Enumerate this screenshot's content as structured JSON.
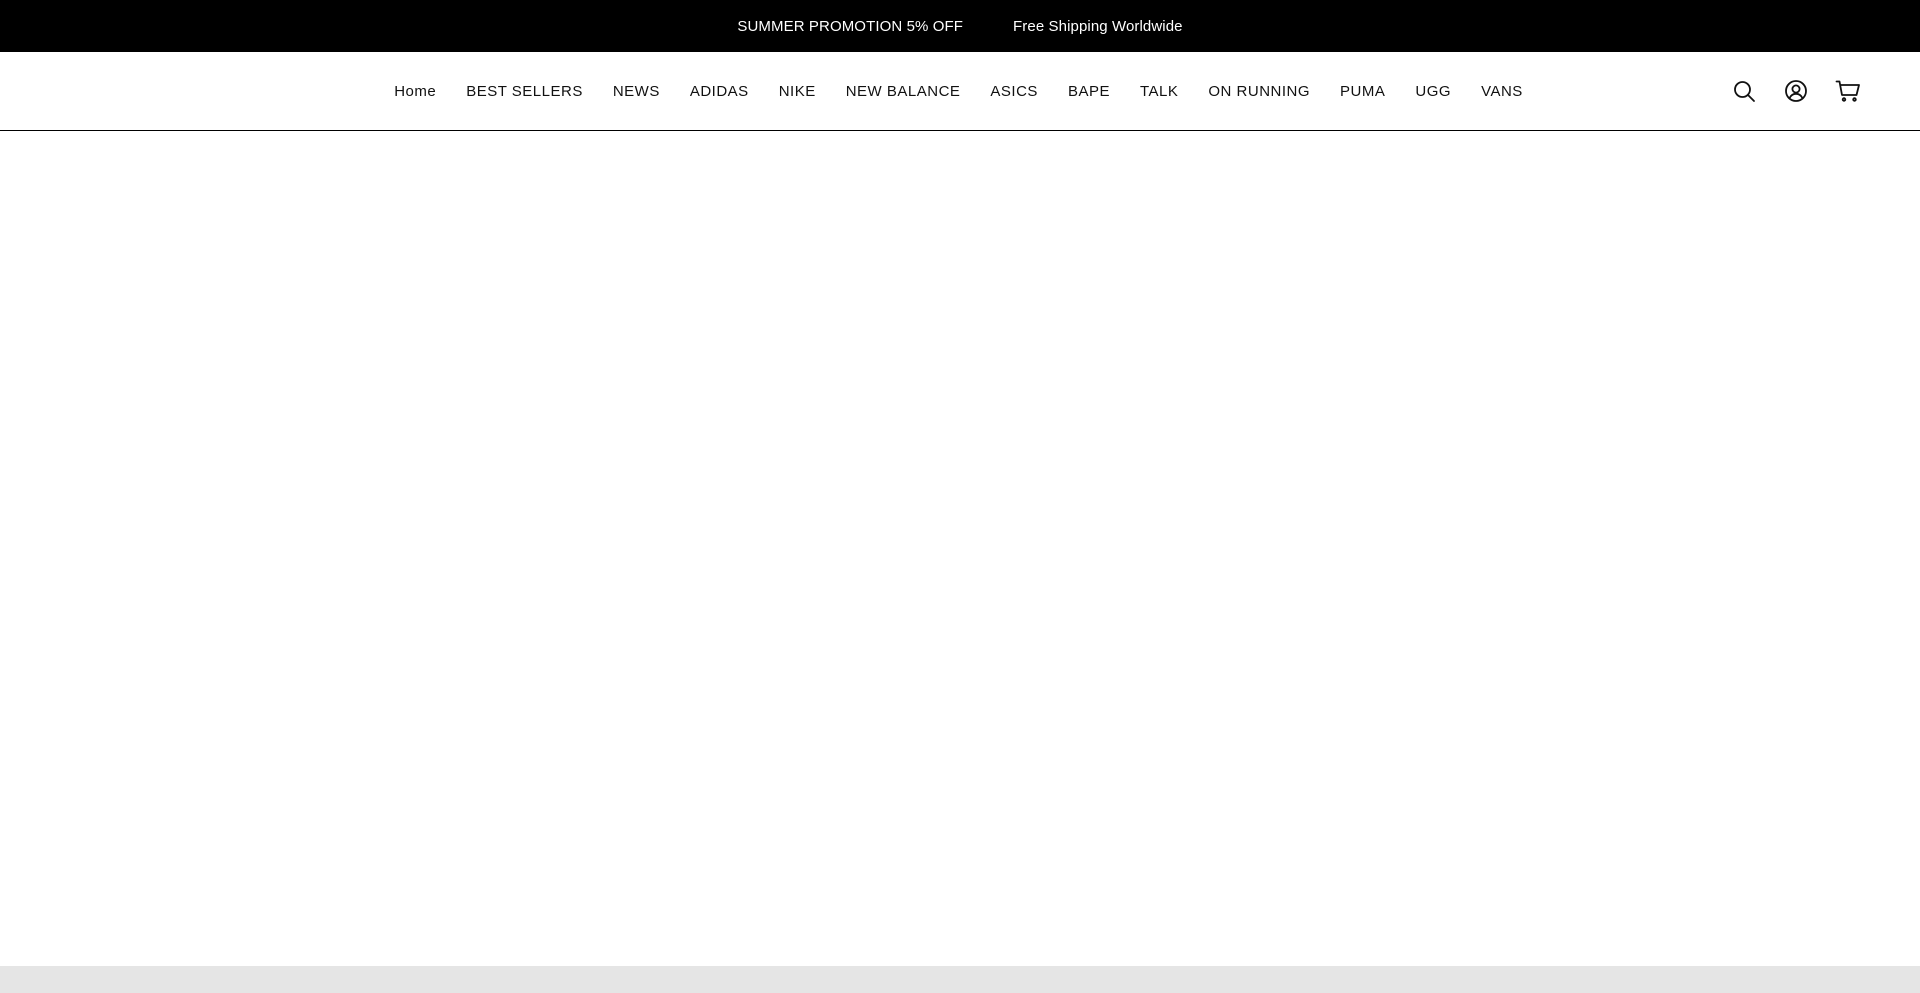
{
  "announcement": {
    "messages": [
      "SUMMER PROMOTION 5% OFF",
      "Free Shipping Worldwide"
    ],
    "background": "#000000",
    "text_color": "#ffffff"
  },
  "nav": {
    "items": [
      {
        "label": "Home"
      },
      {
        "label": "BEST SELLERS"
      },
      {
        "label": "NEWS"
      },
      {
        "label": "ADIDAS"
      },
      {
        "label": "NIKE"
      },
      {
        "label": "NEW BALANCE"
      },
      {
        "label": "ASICS"
      },
      {
        "label": "BAPE"
      },
      {
        "label": "TALK"
      },
      {
        "label": "ON RUNNING"
      },
      {
        "label": "PUMA"
      },
      {
        "label": "UGG"
      },
      {
        "label": "VANS"
      }
    ]
  },
  "header_icons": [
    {
      "name": "search-icon"
    },
    {
      "name": "account-icon"
    },
    {
      "name": "cart-icon"
    }
  ]
}
